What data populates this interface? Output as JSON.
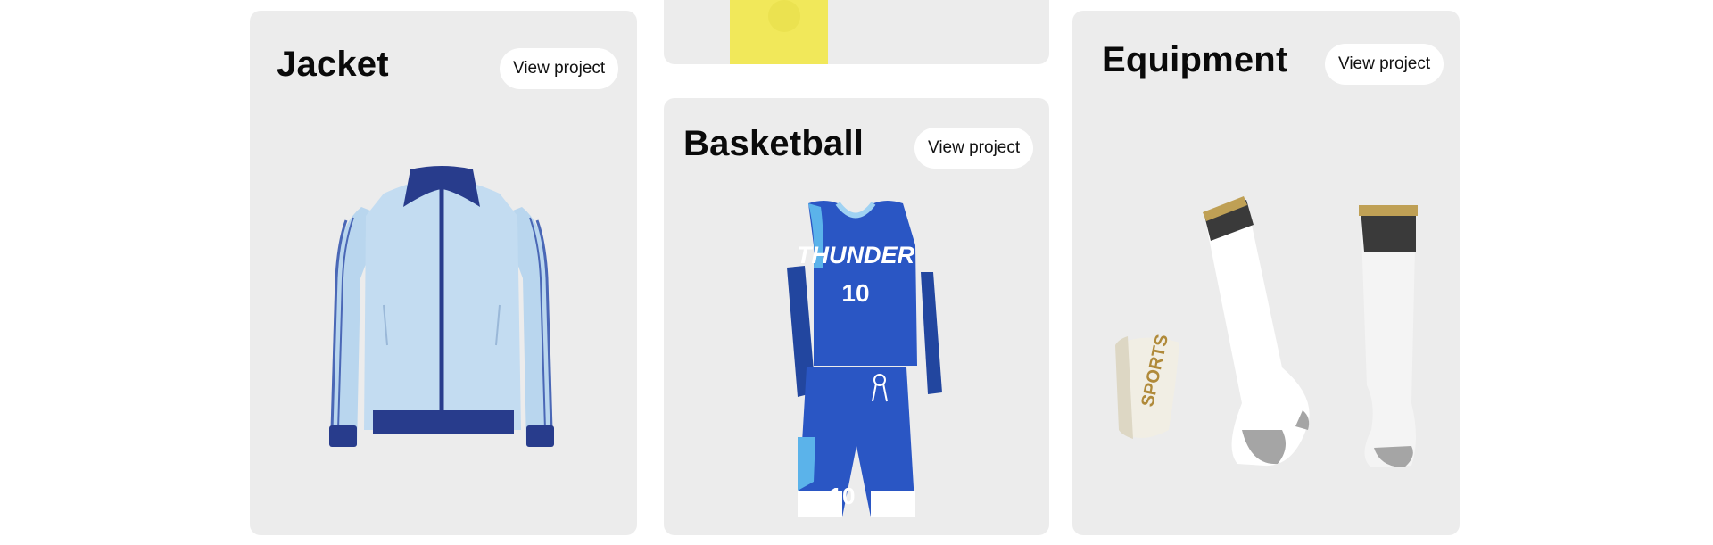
{
  "cards": {
    "jacket": {
      "title": "Jacket",
      "button_label": "View project"
    },
    "basketball": {
      "title": "Basketball",
      "button_label": "View project",
      "jersey_text": "THUNDER",
      "jersey_number": "10",
      "shorts_number": "10"
    },
    "equipment": {
      "title": "Equipment",
      "button_label": "View project",
      "shin_guard_text": "SPORTS"
    }
  },
  "colors": {
    "card_bg": "#ececec",
    "jacket_light": "#b9d6ee",
    "jacket_navy": "#283c8c",
    "jersey_blue": "#2a56c4",
    "sock_band_gold": "#bfa055",
    "product_yellow": "#f1e85a"
  },
  "icons": [
    "jacket-image",
    "basketball-kit-image",
    "equipment-image"
  ]
}
